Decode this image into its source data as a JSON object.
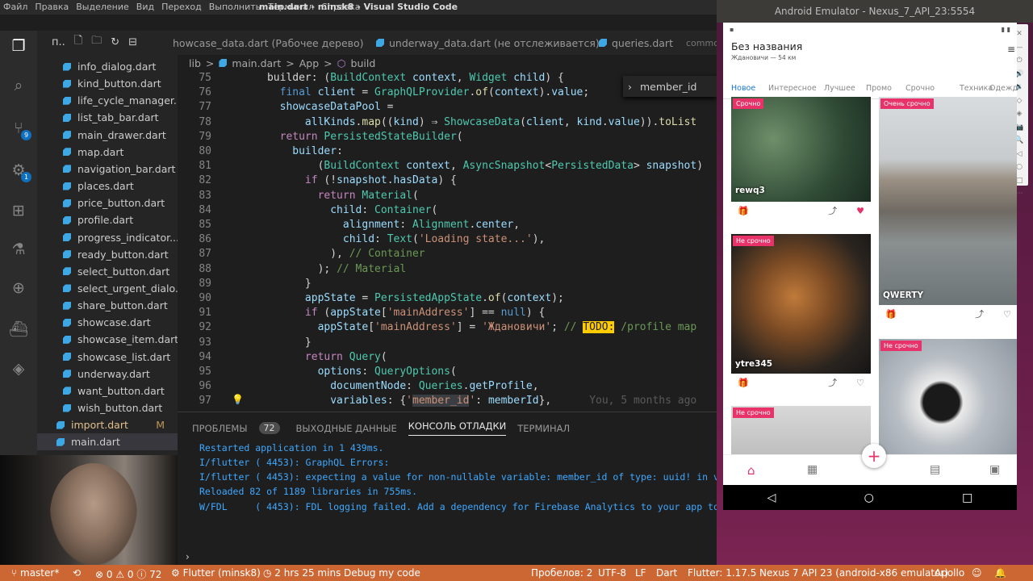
{
  "window": {
    "title": "main.dart - minsk8 - Visual Studio Code",
    "menu": [
      "Файл",
      "Правка",
      "Выделение",
      "Вид",
      "Переход",
      "Выполнить",
      "Терминал",
      "Справка"
    ]
  },
  "sidebar": {
    "header": "п..",
    "files": [
      {
        "name": "info_dialog.dart",
        "m": ""
      },
      {
        "name": "kind_button.dart",
        "m": ""
      },
      {
        "name": "life_cycle_manager....",
        "m": ""
      },
      {
        "name": "list_tab_bar.dart",
        "m": ""
      },
      {
        "name": "main_drawer.dart",
        "m": ""
      },
      {
        "name": "map.dart",
        "m": ""
      },
      {
        "name": "navigation_bar.dart",
        "m": ""
      },
      {
        "name": "places.dart",
        "m": ""
      },
      {
        "name": "price_button.dart",
        "m": ""
      },
      {
        "name": "profile.dart",
        "m": ""
      },
      {
        "name": "progress_indicator....",
        "m": ""
      },
      {
        "name": "ready_button.dart",
        "m": ""
      },
      {
        "name": "select_button.dart",
        "m": ""
      },
      {
        "name": "select_urgent_dialo...",
        "m": ""
      },
      {
        "name": "share_button.dart",
        "m": ""
      },
      {
        "name": "showcase.dart",
        "m": ""
      },
      {
        "name": "showcase_item.dart",
        "m": ""
      },
      {
        "name": "showcase_list.dart",
        "m": ""
      },
      {
        "name": "underway.dart",
        "m": ""
      },
      {
        "name": "want_button.dart",
        "m": ""
      },
      {
        "name": "wish_button.dart",
        "m": ""
      },
      {
        "name": "import.dart",
        "m": "M"
      },
      {
        "name": "main.dart",
        "m": ""
      }
    ]
  },
  "activity": {
    "badges": [
      "9",
      "1"
    ]
  },
  "tabs": [
    "howcase_data.dart (Рабочее дерево)",
    "underway_data.dart (не отслеживается)",
    "queries.dart",
    "commo"
  ],
  "breadcrumb": [
    "lib",
    ">",
    "main.dart",
    ">",
    "App",
    ">",
    "build"
  ],
  "find": {
    "value": "member_id"
  },
  "editor": {
    "lines": [
      {
        "n": "75",
        "html": "      builder: (<span class='ty'>BuildContext</span> <span class='va'>context</span>, <span class='ty'>Widget</span> <span class='va'>child</span>) {"
      },
      {
        "n": "76",
        "html": "        <span class='kb'>final</span> <span class='va'>client</span> = <span class='ty'>GraphQLProvider</span>.<span class='fn'>of</span>(<span class='va'>context</span>).<span class='va'>value</span>;"
      },
      {
        "n": "77",
        "html": "        <span class='va'>showcaseDataPool</span> ="
      },
      {
        "n": "78",
        "html": "            <span class='va'>allKinds</span>.<span class='fn'>map</span>((<span class='va'>kind</span>) ⇒ <span class='ty'>ShowcaseData</span>(<span class='va'>client</span>, <span class='va'>kind</span>.<span class='va'>value</span>)).<span class='fn'>toList</span>"
      },
      {
        "n": "79",
        "html": "        <span class='kw'>return</span> <span class='ty'>PersistedStateBuilder</span>("
      },
      {
        "n": "80",
        "html": "          <span class='va'>builder</span>:"
      },
      {
        "n": "81",
        "html": "              (<span class='ty'>BuildContext</span> <span class='va'>context</span>, <span class='ty'>AsyncSnapshot</span>&lt;<span class='ty'>PersistedData</span>&gt; <span class='va'>snapshot</span>)"
      },
      {
        "n": "82",
        "html": "            <span class='kw'>if</span> (!<span class='va'>snapshot</span>.<span class='va'>hasData</span>) {"
      },
      {
        "n": "83",
        "html": "              <span class='kw'>return</span> <span class='ty'>Material</span>("
      },
      {
        "n": "84",
        "html": "                <span class='va'>child</span>: <span class='ty'>Container</span>("
      },
      {
        "n": "85",
        "html": "                  <span class='va'>alignment</span>: <span class='ty'>Alignment</span>.<span class='va'>center</span>,"
      },
      {
        "n": "86",
        "html": "                  <span class='va'>child</span>: <span class='ty'>Text</span>(<span class='st'>'Loading state...'</span>),"
      },
      {
        "n": "87",
        "html": "                ), <span class='cm'>// Container</span>"
      },
      {
        "n": "88",
        "html": "              ); <span class='cm'>// Material</span>"
      },
      {
        "n": "89",
        "html": "            }"
      },
      {
        "n": "90",
        "html": "            <span class='va'>appState</span> = <span class='ty'>PersistedAppState</span>.<span class='fn'>of</span>(<span class='va'>context</span>);"
      },
      {
        "n": "91",
        "html": "            <span class='kw'>if</span> (<span class='va'>appState</span>[<span class='st'>'mainAddress'</span>] == <span class='kb'>null</span>) {"
      },
      {
        "n": "92",
        "html": "              <span class='va'>appState</span>[<span class='st'>'mainAddress'</span>] = <span class='st'>'Ждановичи'</span>; <span class='cm'>// <span class='todo'>TODO:</span> /profile map</span>"
      },
      {
        "n": "93",
        "html": "            }"
      },
      {
        "n": "94",
        "html": "            <span class='kw'>return</span> <span class='ty'>Query</span>("
      },
      {
        "n": "95",
        "html": "              <span class='va'>options</span>: <span class='ty'>QueryOptions</span>("
      },
      {
        "n": "96",
        "html": "                <span class='va'>documentNode</span>: <span class='ty'>Queries</span>.<span class='va'>getProfile</span>,"
      },
      {
        "n": "97",
        "html": "                <span class='va'>variables</span>: {<span class='st'>'<span class='sel'>member_id</span>'</span>: <span class='va'>memberId</span>},      <span style='color:#5a5a5a'>You, 5 months ago</span>"
      }
    ]
  },
  "panel": {
    "tabs": [
      "ПРОБЛЕМЫ",
      "ВЫХОДНЫЕ ДАННЫЕ",
      "КОНСОЛЬ ОТЛАДКИ",
      "ТЕРМИНАЛ"
    ],
    "problems_count": "72",
    "console": [
      "Restarted application in 1 439ms.",
      "I/flutter ( 4453): GraphQL Errors:",
      "I/flutter ( 4453): expecting a value for non-nullable variable: member_id of type: uuid! in var",
      "Reloaded 82 of 1189 libraries in 755ms.",
      "W/FDL     ( 4453): FDL logging failed. Add a dependency for Firebase Analytics to your app to en"
    ]
  },
  "status": {
    "branch": "master*",
    "sync": "⟲",
    "problems": "⊗ 0 ⚠ 0 ⓘ 72",
    "flutter": "Flutter (minsk8)",
    "time": "2 hrs 25 mins",
    "debug": "Debug my code",
    "spaces": "Пробелов: 2",
    "encoding": "UTF-8",
    "eol": "LF",
    "lang": "Dart",
    "flutterv": "Flutter: 1.17.5",
    "device": "Nexus 7 API 23 (android-x86 emulator)",
    "apollo": "Apollo"
  },
  "emulator": {
    "title": "Android Emulator - Nexus_7_API_23:5554",
    "app_title": "Без названия",
    "app_sub": "Ждановичи — 54 км",
    "channels": [
      "Новое",
      "Интересное",
      "Лучшее",
      "Промо",
      "Срочно",
      "Техника",
      "Одежд"
    ],
    "cards": [
      {
        "tag": "Срочно",
        "name": "rewq3"
      },
      {
        "tag": "Очень срочно",
        "name": "QWERTY"
      },
      {
        "tag": "Не срочно",
        "name": "ytre345"
      },
      {
        "tag": "Не срочно",
        "name": ""
      },
      {
        "tag": "Не срочно",
        "name": ""
      }
    ],
    "accent": "#e8336a"
  }
}
